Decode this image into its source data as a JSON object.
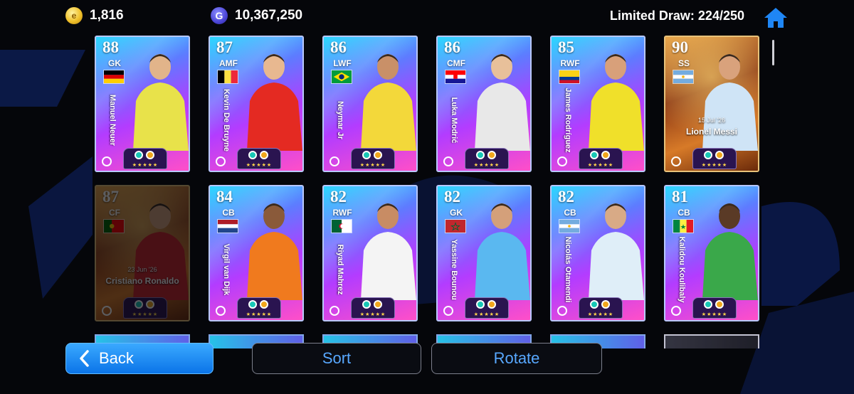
{
  "header": {
    "coins": "1,816",
    "gp": "10,367,250",
    "gp_symbol": "G",
    "coin_symbol": "e",
    "limited_draw": "Limited Draw: 224/250"
  },
  "rating_stars": "★★★★★",
  "cards": [
    {
      "ovr": "88",
      "pos": "GK",
      "name": "Manuel Neuer",
      "style": "blue",
      "flag": "germany",
      "shirt": "#e8e24a",
      "skin": "#e2b48a"
    },
    {
      "ovr": "87",
      "pos": "AMF",
      "name": "Kevin De Bruyne",
      "style": "blue",
      "flag": "belgium",
      "shirt": "#e42a22",
      "skin": "#e8b890"
    },
    {
      "ovr": "86",
      "pos": "LWF",
      "name": "Neymar Jr",
      "style": "blue",
      "flag": "brazil",
      "shirt": "#f3d83a",
      "skin": "#c99068"
    },
    {
      "ovr": "86",
      "pos": "CMF",
      "name": "Luka Modrić",
      "style": "blue",
      "flag": "croatia",
      "shirt": "#e8e8e8",
      "skin": "#e8c09a"
    },
    {
      "ovr": "85",
      "pos": "RWF",
      "name": "James Rodríguez",
      "style": "blue",
      "flag": "colombia",
      "shirt": "#f0e02a",
      "skin": "#d8a07a"
    },
    {
      "ovr": "90",
      "pos": "SS",
      "name": "Lionel Messi",
      "date": "15 Jul '26",
      "style": "gold",
      "flag": "argentina",
      "shirt": "#cfe4f6",
      "skin": "#d9a27c"
    },
    {
      "ovr": "87",
      "pos": "CF",
      "name": "Cristiano Ronaldo",
      "date": "23 Jun '26",
      "style": "gold",
      "faded": true,
      "flag": "portugal",
      "shirt": "#c8242a",
      "skin": "#d4a07c"
    },
    {
      "ovr": "84",
      "pos": "CB",
      "name": "Virgil van Dijk",
      "style": "blue",
      "flag": "netherlands",
      "shirt": "#f07a1e",
      "skin": "#8a5a3a"
    },
    {
      "ovr": "82",
      "pos": "RWF",
      "name": "Riyad Mahrez",
      "style": "blue",
      "flag": "algeria",
      "shirt": "#f4f4f4",
      "skin": "#c88c64"
    },
    {
      "ovr": "82",
      "pos": "GK",
      "name": "Yassine Bounou",
      "style": "blue",
      "flag": "morocco",
      "shirt": "#5ab8f0",
      "skin": "#d4a07a"
    },
    {
      "ovr": "82",
      "pos": "CB",
      "name": "Nicolás Otamendi",
      "style": "blue",
      "flag": "argentina",
      "shirt": "#dfeef8",
      "skin": "#d8aa86"
    },
    {
      "ovr": "81",
      "pos": "CB",
      "name": "Kalidou Koulibaly",
      "style": "blue",
      "flag": "senegal",
      "shirt": "#3aa84a",
      "skin": "#5a3a26"
    }
  ],
  "buttons": {
    "back": "Back",
    "sort": "Sort",
    "rotate": "Rotate"
  },
  "colors": {
    "accent_blue": "#0b74e8",
    "button_text_blue": "#58a8ff"
  }
}
